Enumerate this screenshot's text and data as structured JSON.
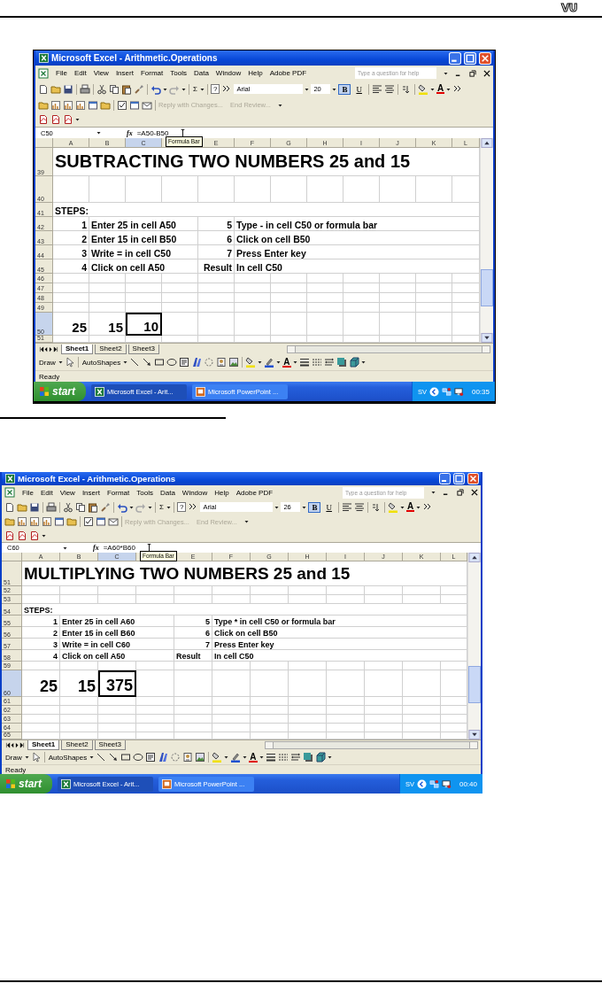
{
  "page_header": {
    "logo": "VU"
  },
  "screenshots": [
    {
      "title": "Microsoft Excel - Arithmetic.Operations",
      "menu": [
        "File",
        "Edit",
        "View",
        "Insert",
        "Format",
        "Tools",
        "Data",
        "Window",
        "Help",
        "Adobe PDF"
      ],
      "help_box": {
        "placeholder": "Type a question for help"
      },
      "toolbar": {
        "autosum": "Σ",
        "help": "?",
        "font": "Arial",
        "size": "20",
        "font_color": "A"
      },
      "format_buttons": [
        {
          "label": "B",
          "selected": true
        },
        {
          "label": "U",
          "selected": false
        }
      ],
      "review": [
        "Reply with Changes...",
        "End Review..."
      ],
      "name_box": "C50",
      "fx": "fx",
      "formula": "=A50-B50",
      "tooltip": "Formula Bar",
      "columns": [
        {
          "label": "A",
          "selected": false
        },
        {
          "label": "B",
          "selected": false
        },
        {
          "label": "C",
          "selected": true
        },
        {
          "selected": false
        },
        {
          "label": "E",
          "selected": false
        },
        {
          "label": "F",
          "selected": false
        },
        {
          "label": "G",
          "selected": false
        },
        {
          "label": "H",
          "selected": false
        },
        {
          "label": "I",
          "selected": false
        },
        {
          "label": "J",
          "selected": false
        },
        {
          "label": "K",
          "selected": false
        },
        {
          "label": "L",
          "selected": false
        }
      ],
      "rows": [
        {
          "number": "39",
          "kind": "title",
          "selected": false,
          "cells": {
            "A": {
              "text": "SUBTRACTING TWO NUMBERS 25 and 15",
              "kind": "text",
              "selected": false
            }
          }
        },
        {
          "number": "40",
          "kind": "spacer",
          "selected": false
        },
        {
          "number": "41",
          "kind": "step",
          "selected": false,
          "cells": {
            "A": {
              "text": "STEPS:",
              "kind": "text",
              "selected": false
            }
          }
        },
        {
          "number": "42",
          "kind": "step",
          "selected": false,
          "cells": {
            "A": {
              "text": "1",
              "kind": "number",
              "selected": false
            },
            "B": {
              "text": "Enter 25 in cell A50",
              "kind": "text",
              "selected": false
            },
            "E": {
              "text": "5",
              "kind": "number",
              "selected": false
            },
            "F": {
              "text": "Type - in cell C50 or formula bar",
              "kind": "text",
              "selected": false
            }
          }
        },
        {
          "number": "43",
          "kind": "step",
          "selected": false,
          "cells": {
            "A": {
              "text": "2",
              "kind": "number",
              "selected": false
            },
            "B": {
              "text": "Enter 15 in cell B50",
              "kind": "text",
              "selected": false
            },
            "E": {
              "text": "6",
              "kind": "number",
              "selected": false
            },
            "F": {
              "text": "Click on cell B50",
              "kind": "text",
              "selected": false
            }
          }
        },
        {
          "number": "44",
          "kind": "step",
          "selected": false,
          "cells": {
            "A": {
              "text": "3",
              "kind": "number",
              "selected": false
            },
            "B": {
              "text": "Write = in cell C50",
              "kind": "text",
              "selected": false
            },
            "E": {
              "text": "7",
              "kind": "number",
              "selected": false
            },
            "F": {
              "text": "Press Enter key",
              "kind": "text",
              "selected": false
            }
          }
        },
        {
          "number": "45",
          "kind": "step",
          "selected": false,
          "cells": {
            "A": {
              "text": "4",
              "kind": "number",
              "selected": false
            },
            "B": {
              "text": "Click on cell A50",
              "kind": "text",
              "selected": false
            },
            "E": {
              "text": "Result",
              "kind": "label",
              "selected": false
            },
            "F": {
              "text": "In cell C50",
              "kind": "text",
              "selected": false
            }
          }
        },
        {
          "number": "46",
          "kind": "blank",
          "selected": false
        },
        {
          "number": "47",
          "kind": "blank",
          "selected": false
        },
        {
          "number": "48",
          "kind": "blank",
          "selected": false
        },
        {
          "number": "49",
          "kind": "blank",
          "selected": false
        },
        {
          "number": "50",
          "kind": "number",
          "selected": true,
          "cells": {
            "A": {
              "text": "25",
              "kind": "number",
              "selected": false
            },
            "B": {
              "text": "15",
              "kind": "number",
              "selected": false
            },
            "C": {
              "text": "10",
              "kind": "number",
              "selected": true
            }
          }
        },
        {
          "number": "51",
          "kind": "partial",
          "selected": false
        }
      ],
      "sheet_tabs": [
        {
          "label": "Sheet1",
          "selected": true
        },
        {
          "label": "Sheet2",
          "selected": false
        },
        {
          "label": "Sheet3",
          "selected": false
        }
      ],
      "drawing_toolbar": {
        "draw": "Draw",
        "autoshapes": "AutoShapes",
        "font_color": "A"
      },
      "status": "Ready",
      "taskbar": {
        "start": "start",
        "tasks": [
          {
            "label": "Microsoft Excel - Arit...",
            "selected": true
          },
          {
            "label": "Microsoft PowerPoint ...",
            "selected": false
          }
        ],
        "tray": "SV",
        "clock": "00:35"
      }
    },
    {
      "title": "Microsoft Excel - Arithmetic.Operations",
      "menu": [
        "File",
        "Edit",
        "View",
        "Insert",
        "Format",
        "Tools",
        "Data",
        "Window",
        "Help",
        "Adobe PDF"
      ],
      "help_box": {
        "placeholder": "Type a question for help"
      },
      "toolbar": {
        "autosum": "Σ",
        "help": "?",
        "font": "Arial",
        "size": "26",
        "font_color": "A"
      },
      "format_buttons": [
        {
          "label": "B",
          "selected": true
        },
        {
          "label": "U",
          "selected": false
        }
      ],
      "review": [
        "Reply with Changes...",
        "End Review..."
      ],
      "name_box": "C60",
      "fx": "fx",
      "formula": "=A60*B60",
      "tooltip": "Formula Bar",
      "columns": [
        {
          "label": "A",
          "selected": false
        },
        {
          "label": "B",
          "selected": false
        },
        {
          "label": "C",
          "selected": true
        },
        {
          "selected": false
        },
        {
          "label": "E",
          "selected": false
        },
        {
          "label": "F",
          "selected": false
        },
        {
          "label": "G",
          "selected": false
        },
        {
          "label": "H",
          "selected": false
        },
        {
          "label": "I",
          "selected": false
        },
        {
          "label": "J",
          "selected": false
        },
        {
          "label": "K",
          "selected": false
        },
        {
          "label": "L",
          "selected": false
        }
      ],
      "rows": [
        {
          "number": "51",
          "kind": "title",
          "selected": false,
          "cells": {
            "A": {
              "text": "MULTIPLYING TWO NUMBERS 25 and 15",
              "kind": "text",
              "selected": false
            }
          }
        },
        {
          "number": "52",
          "kind": "blank",
          "selected": false
        },
        {
          "number": "53",
          "kind": "blank",
          "selected": false
        },
        {
          "number": "54",
          "kind": "step",
          "selected": false,
          "cells": {
            "A": {
              "text": "STEPS:",
              "kind": "text",
              "selected": false
            }
          }
        },
        {
          "number": "55",
          "kind": "step",
          "selected": false,
          "cells": {
            "A": {
              "text": "1",
              "kind": "number",
              "selected": false
            },
            "B": {
              "text": "Enter 25 in cell A60",
              "kind": "text",
              "selected": false
            },
            "E": {
              "text": "5",
              "kind": "number",
              "selected": false
            },
            "F": {
              "text": "Type * in cell C50 or formula bar",
              "kind": "text",
              "selected": false
            }
          }
        },
        {
          "number": "56",
          "kind": "step",
          "selected": false,
          "cells": {
            "A": {
              "text": "2",
              "kind": "number",
              "selected": false
            },
            "B": {
              "text": "Enter 15 in cell B60",
              "kind": "text",
              "selected": false
            },
            "E": {
              "text": "6",
              "kind": "number",
              "selected": false
            },
            "F": {
              "text": "Click on cell B50",
              "kind": "text",
              "selected": false
            }
          }
        },
        {
          "number": "57",
          "kind": "step",
          "selected": false,
          "cells": {
            "A": {
              "text": "3",
              "kind": "number",
              "selected": false
            },
            "B": {
              "text": "Write = in cell C60",
              "kind": "text",
              "selected": false
            },
            "E": {
              "text": "7",
              "kind": "number",
              "selected": false
            },
            "F": {
              "text": "Press Enter key",
              "kind": "text",
              "selected": false
            }
          }
        },
        {
          "number": "58",
          "kind": "step",
          "selected": false,
          "cells": {
            "A": {
              "text": "4",
              "kind": "number",
              "selected": false
            },
            "B": {
              "text": "Click on cell A50",
              "kind": "text",
              "selected": false
            },
            "E": {
              "text": "Result",
              "kind": "text",
              "selected": false
            },
            "F": {
              "text": "In cell C50",
              "kind": "text",
              "selected": false
            }
          }
        },
        {
          "number": "59",
          "kind": "blank",
          "selected": false
        },
        {
          "number": "60",
          "kind": "number",
          "selected": true,
          "cells": {
            "A": {
              "text": "25",
              "kind": "number",
              "selected": false
            },
            "B": {
              "text": "15",
              "kind": "number",
              "selected": false
            },
            "C": {
              "text": "375",
              "kind": "number",
              "selected": true
            }
          }
        },
        {
          "number": "61",
          "kind": "blank",
          "selected": false
        },
        {
          "number": "62",
          "kind": "blank",
          "selected": false
        },
        {
          "number": "63",
          "kind": "blank",
          "selected": false
        },
        {
          "number": "64",
          "kind": "blank",
          "selected": false
        },
        {
          "number": "65",
          "kind": "partial",
          "selected": false
        }
      ],
      "sheet_tabs": [
        {
          "label": "Sheet1",
          "selected": true
        },
        {
          "label": "Sheet2",
          "selected": false
        },
        {
          "label": "Sheet3",
          "selected": false
        }
      ],
      "drawing_toolbar": {
        "draw": "Draw",
        "autoshapes": "AutoShapes",
        "font_color": "A"
      },
      "status": "Ready",
      "taskbar": {
        "start": "start",
        "tasks": [
          {
            "label": "Microsoft Excel - Arit...",
            "selected": true
          },
          {
            "label": "Microsoft PowerPoint ...",
            "selected": false
          }
        ],
        "tray": "SV",
        "clock": "00:40"
      }
    }
  ]
}
